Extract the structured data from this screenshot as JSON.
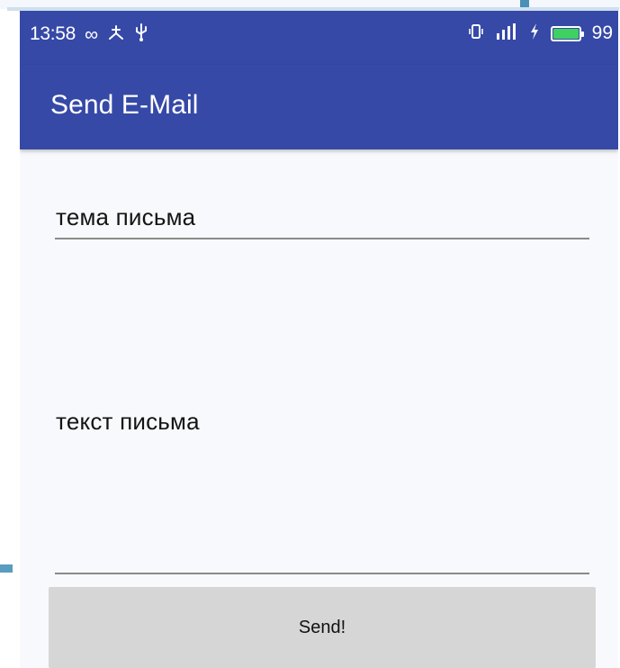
{
  "status_bar": {
    "time": "13:58",
    "icons_left": [
      "infinity-icon",
      "usb-debug-icon",
      "usb-icon"
    ],
    "icons_right": [
      "vibrate-icon",
      "signal-icon",
      "charging-icon",
      "battery-icon"
    ],
    "battery_level": "99",
    "battery_color": "#3ed15f"
  },
  "app_bar": {
    "title": "Send E-Mail",
    "color": "#3649a7"
  },
  "form": {
    "subject_placeholder": "тема письма",
    "body_placeholder": "текст письма",
    "send_label": "Send!"
  }
}
